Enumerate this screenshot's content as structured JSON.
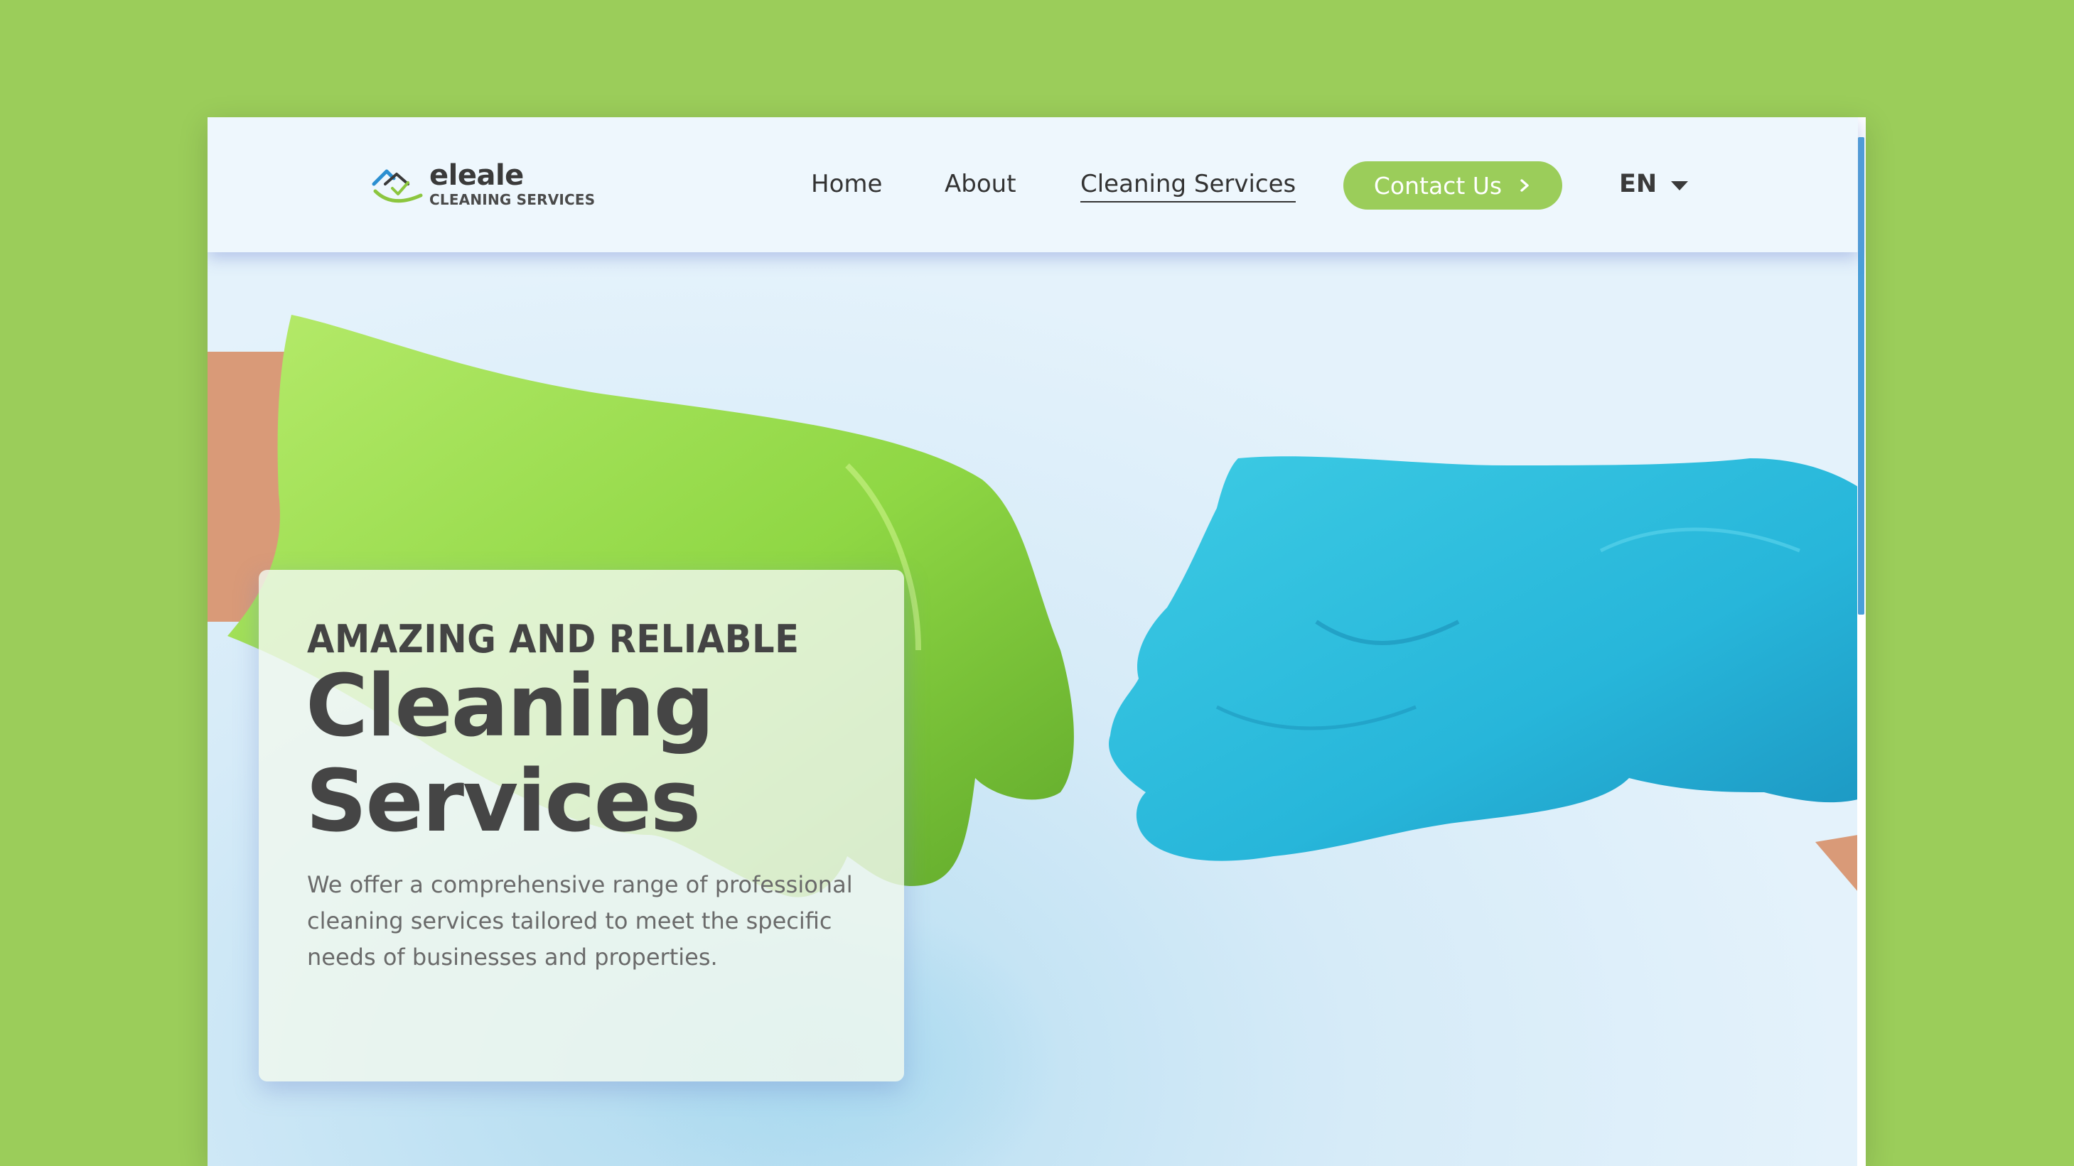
{
  "brand": {
    "name": "eleale",
    "tagline": "CLEANING SERVICES"
  },
  "nav": {
    "links": [
      {
        "label": "Home"
      },
      {
        "label": "About"
      },
      {
        "label": "Cleaning Services",
        "active": true
      }
    ],
    "contact_label": "Contact Us",
    "language": "EN"
  },
  "hero": {
    "eyebrow": "AMAZING AND RELIABLE",
    "title_line1": "Cleaning",
    "title_line2": "Services",
    "description": "We offer a comprehensive range of professional cleaning services tailored to meet the specific needs of businesses and properties."
  },
  "colors": {
    "accent_green": "#9bcd5a",
    "glove_blue": "#2bbfde",
    "glove_green": "#8fd744",
    "text_dark": "#454545"
  },
  "icons": {
    "logo": "house-check-logo-icon",
    "contact_arrow": "chevron-right-icon",
    "language_caret": "caret-down-icon"
  }
}
